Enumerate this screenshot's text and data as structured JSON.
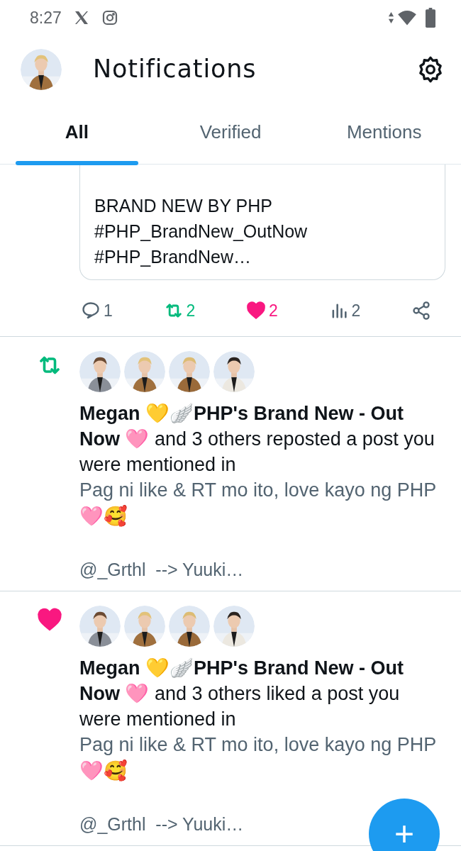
{
  "status_bar": {
    "time": "8:27"
  },
  "header": {
    "title": "Notifications"
  },
  "tabs": [
    {
      "label": "All",
      "selected": true
    },
    {
      "label": "Verified",
      "selected": false
    },
    {
      "label": "Mentions",
      "selected": false
    }
  ],
  "quoted_post": {
    "lines": [
      "BRAND NEW BY PHP",
      "#PHP_BrandNew_OutNow",
      "#PHP_BrandNew…"
    ]
  },
  "actions": [
    {
      "kind": "reply",
      "count": "1"
    },
    {
      "kind": "repost",
      "count": "2",
      "active": true
    },
    {
      "kind": "like",
      "count": "2",
      "active": true
    },
    {
      "kind": "views",
      "count": "2"
    },
    {
      "kind": "share"
    }
  ],
  "notifications": [
    {
      "kind": "repost",
      "text": "**Megan 💛🪽PHP's Brand New - Out Now 🩷** and 3 others reposted a post you were mentioned in",
      "preview": "Pag ni like & RT mo ito, love kayo ng PHP 🩷🥰",
      "handle_line": "@_Grthl  --> Yuuki…"
    },
    {
      "kind": "like",
      "text": "**Megan 💛🪽PHP's Brand New - Out Now 🩷** and 3 others liked a post you were mentioned in",
      "preview": "Pag ni like & RT mo ito, love kayo ng PHP 🩷🥰",
      "handle_line": "@_Grthl  --> Yuuki…"
    }
  ],
  "fab": {
    "label": "+"
  }
}
